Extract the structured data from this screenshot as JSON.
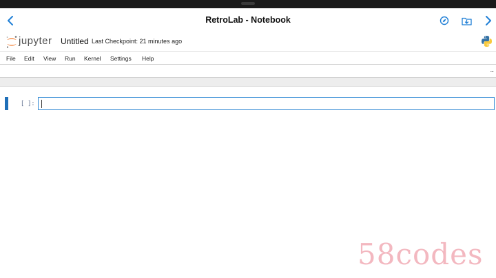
{
  "nav": {
    "title": "RetroLab - Notebook"
  },
  "header": {
    "logo_text": "jupyter",
    "notebook_name": "Untitled",
    "checkpoint": "Last Checkpoint: 21 minutes ago"
  },
  "menu": {
    "items": [
      {
        "label": "File"
      },
      {
        "label": "Edit"
      },
      {
        "label": "View"
      },
      {
        "label": "Run"
      },
      {
        "label": "Kernel"
      },
      {
        "label": "Settings"
      },
      {
        "label": "Help"
      }
    ]
  },
  "toolbar": {
    "more_label": "..."
  },
  "cell": {
    "prompt": "[ ]:",
    "content": ""
  },
  "watermark": "58codes",
  "colors": {
    "accent": "#1f7fd6",
    "cell_active": "#1f6fb8",
    "jupyter_orange": "#f37726"
  }
}
